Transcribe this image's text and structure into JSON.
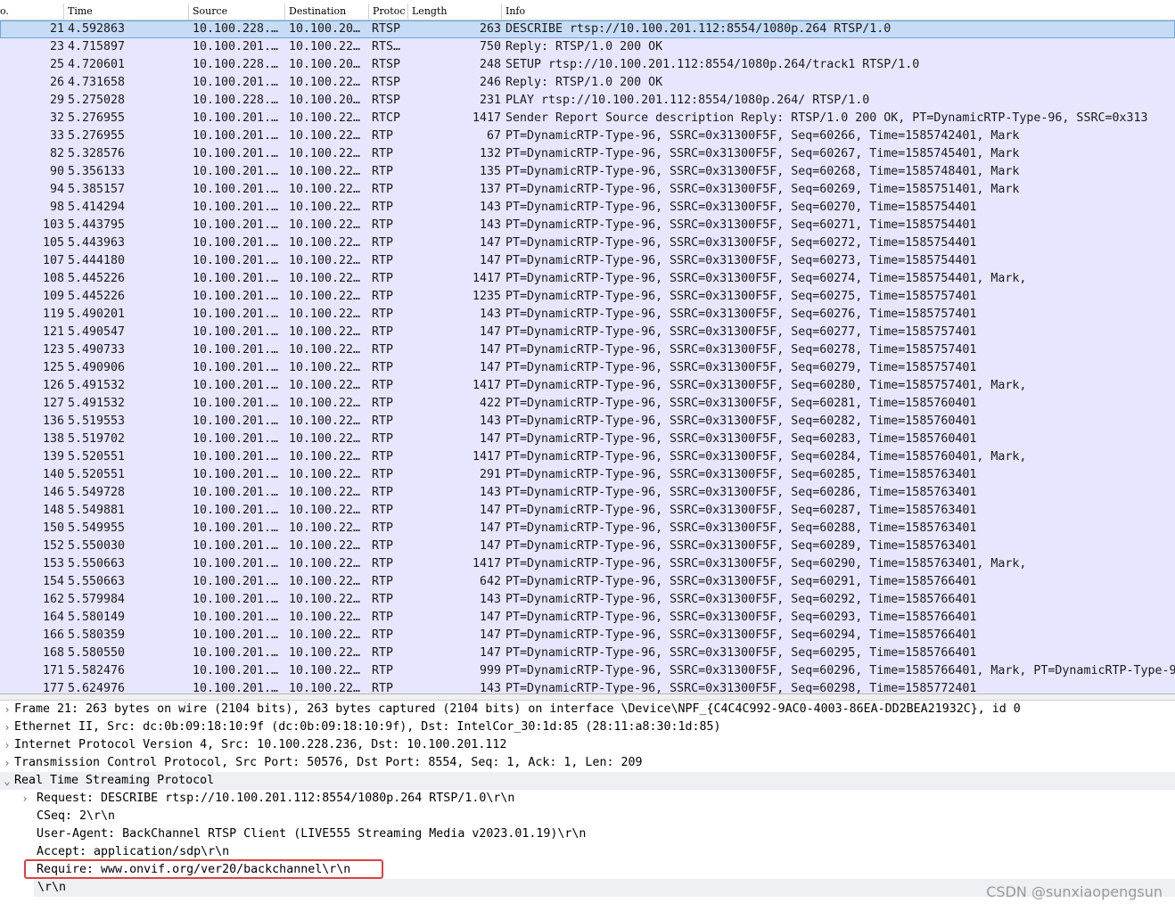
{
  "packet_list": {
    "columns": [
      "o.",
      "Time",
      "Source",
      "Destination",
      "Protoc",
      "Length",
      "Info"
    ],
    "rows": [
      {
        "no": "21",
        "time": "4.592863",
        "src": "10.100.228.…",
        "dst": "10.100.20…",
        "proto": "RTSP",
        "len": "263",
        "info": "DESCRIBE rtsp://10.100.201.112:8554/1080p.264 RTSP/1.0",
        "selected": true
      },
      {
        "no": "23",
        "time": "4.715897",
        "src": "10.100.201.…",
        "dst": "10.100.22…",
        "proto": "RTS…",
        "len": "750",
        "info": "Reply: RTSP/1.0 200 OK"
      },
      {
        "no": "25",
        "time": "4.720601",
        "src": "10.100.228.…",
        "dst": "10.100.20…",
        "proto": "RTSP",
        "len": "248",
        "info": "SETUP rtsp://10.100.201.112:8554/1080p.264/track1 RTSP/1.0"
      },
      {
        "no": "26",
        "time": "4.731658",
        "src": "10.100.201.…",
        "dst": "10.100.22…",
        "proto": "RTSP",
        "len": "246",
        "info": "Reply: RTSP/1.0 200 OK"
      },
      {
        "no": "29",
        "time": "5.275028",
        "src": "10.100.228.…",
        "dst": "10.100.20…",
        "proto": "RTSP",
        "len": "231",
        "info": "PLAY rtsp://10.100.201.112:8554/1080p.264/ RTSP/1.0"
      },
      {
        "no": "32",
        "time": "5.276955",
        "src": "10.100.201.…",
        "dst": "10.100.22…",
        "proto": "RTCP",
        "len": "1417",
        "info": "Sender Report   Source description   Reply: RTSP/1.0 200 OK, PT=DynamicRTP-Type-96, SSRC=0x313"
      },
      {
        "no": "33",
        "time": "5.276955",
        "src": "10.100.201.…",
        "dst": "10.100.22…",
        "proto": "RTP",
        "len": "67",
        "info": "PT=DynamicRTP-Type-96, SSRC=0x31300F5F, Seq=60266, Time=1585742401, Mark"
      },
      {
        "no": "82",
        "time": "5.328576",
        "src": "10.100.201.…",
        "dst": "10.100.22…",
        "proto": "RTP",
        "len": "132",
        "info": "PT=DynamicRTP-Type-96, SSRC=0x31300F5F, Seq=60267, Time=1585745401, Mark"
      },
      {
        "no": "90",
        "time": "5.356133",
        "src": "10.100.201.…",
        "dst": "10.100.22…",
        "proto": "RTP",
        "len": "135",
        "info": "PT=DynamicRTP-Type-96, SSRC=0x31300F5F, Seq=60268, Time=1585748401, Mark"
      },
      {
        "no": "94",
        "time": "5.385157",
        "src": "10.100.201.…",
        "dst": "10.100.22…",
        "proto": "RTP",
        "len": "137",
        "info": "PT=DynamicRTP-Type-96, SSRC=0x31300F5F, Seq=60269, Time=1585751401, Mark"
      },
      {
        "no": "98",
        "time": "5.414294",
        "src": "10.100.201.…",
        "dst": "10.100.22…",
        "proto": "RTP",
        "len": "143",
        "info": "PT=DynamicRTP-Type-96, SSRC=0x31300F5F, Seq=60270, Time=1585754401"
      },
      {
        "no": "103",
        "time": "5.443795",
        "src": "10.100.201.…",
        "dst": "10.100.22…",
        "proto": "RTP",
        "len": "143",
        "info": "PT=DynamicRTP-Type-96, SSRC=0x31300F5F, Seq=60271, Time=1585754401"
      },
      {
        "no": "105",
        "time": "5.443963",
        "src": "10.100.201.…",
        "dst": "10.100.22…",
        "proto": "RTP",
        "len": "147",
        "info": "PT=DynamicRTP-Type-96, SSRC=0x31300F5F, Seq=60272, Time=1585754401"
      },
      {
        "no": "107",
        "time": "5.444180",
        "src": "10.100.201.…",
        "dst": "10.100.22…",
        "proto": "RTP",
        "len": "147",
        "info": "PT=DynamicRTP-Type-96, SSRC=0x31300F5F, Seq=60273, Time=1585754401"
      },
      {
        "no": "108",
        "time": "5.445226",
        "src": "10.100.201.…",
        "dst": "10.100.22…",
        "proto": "RTP",
        "len": "1417",
        "info": "PT=DynamicRTP-Type-96, SSRC=0x31300F5F, Seq=60274, Time=1585754401, Mark,"
      },
      {
        "no": "109",
        "time": "5.445226",
        "src": "10.100.201.…",
        "dst": "10.100.22…",
        "proto": "RTP",
        "len": "1235",
        "info": "PT=DynamicRTP-Type-96, SSRC=0x31300F5F, Seq=60275, Time=1585757401"
      },
      {
        "no": "119",
        "time": "5.490201",
        "src": "10.100.201.…",
        "dst": "10.100.22…",
        "proto": "RTP",
        "len": "143",
        "info": "PT=DynamicRTP-Type-96, SSRC=0x31300F5F, Seq=60276, Time=1585757401"
      },
      {
        "no": "121",
        "time": "5.490547",
        "src": "10.100.201.…",
        "dst": "10.100.22…",
        "proto": "RTP",
        "len": "147",
        "info": "PT=DynamicRTP-Type-96, SSRC=0x31300F5F, Seq=60277, Time=1585757401"
      },
      {
        "no": "123",
        "time": "5.490733",
        "src": "10.100.201.…",
        "dst": "10.100.22…",
        "proto": "RTP",
        "len": "147",
        "info": "PT=DynamicRTP-Type-96, SSRC=0x31300F5F, Seq=60278, Time=1585757401"
      },
      {
        "no": "125",
        "time": "5.490906",
        "src": "10.100.201.…",
        "dst": "10.100.22…",
        "proto": "RTP",
        "len": "147",
        "info": "PT=DynamicRTP-Type-96, SSRC=0x31300F5F, Seq=60279, Time=1585757401"
      },
      {
        "no": "126",
        "time": "5.491532",
        "src": "10.100.201.…",
        "dst": "10.100.22…",
        "proto": "RTP",
        "len": "1417",
        "info": "PT=DynamicRTP-Type-96, SSRC=0x31300F5F, Seq=60280, Time=1585757401, Mark,"
      },
      {
        "no": "127",
        "time": "5.491532",
        "src": "10.100.201.…",
        "dst": "10.100.22…",
        "proto": "RTP",
        "len": "422",
        "info": "PT=DynamicRTP-Type-96, SSRC=0x31300F5F, Seq=60281, Time=1585760401"
      },
      {
        "no": "136",
        "time": "5.519553",
        "src": "10.100.201.…",
        "dst": "10.100.22…",
        "proto": "RTP",
        "len": "143",
        "info": "PT=DynamicRTP-Type-96, SSRC=0x31300F5F, Seq=60282, Time=1585760401"
      },
      {
        "no": "138",
        "time": "5.519702",
        "src": "10.100.201.…",
        "dst": "10.100.22…",
        "proto": "RTP",
        "len": "147",
        "info": "PT=DynamicRTP-Type-96, SSRC=0x31300F5F, Seq=60283, Time=1585760401"
      },
      {
        "no": "139",
        "time": "5.520551",
        "src": "10.100.201.…",
        "dst": "10.100.22…",
        "proto": "RTP",
        "len": "1417",
        "info": "PT=DynamicRTP-Type-96, SSRC=0x31300F5F, Seq=60284, Time=1585760401, Mark,"
      },
      {
        "no": "140",
        "time": "5.520551",
        "src": "10.100.201.…",
        "dst": "10.100.22…",
        "proto": "RTP",
        "len": "291",
        "info": "PT=DynamicRTP-Type-96, SSRC=0x31300F5F, Seq=60285, Time=1585763401"
      },
      {
        "no": "146",
        "time": "5.549728",
        "src": "10.100.201.…",
        "dst": "10.100.22…",
        "proto": "RTP",
        "len": "143",
        "info": "PT=DynamicRTP-Type-96, SSRC=0x31300F5F, Seq=60286, Time=1585763401"
      },
      {
        "no": "148",
        "time": "5.549881",
        "src": "10.100.201.…",
        "dst": "10.100.22…",
        "proto": "RTP",
        "len": "147",
        "info": "PT=DynamicRTP-Type-96, SSRC=0x31300F5F, Seq=60287, Time=1585763401"
      },
      {
        "no": "150",
        "time": "5.549955",
        "src": "10.100.201.…",
        "dst": "10.100.22…",
        "proto": "RTP",
        "len": "147",
        "info": "PT=DynamicRTP-Type-96, SSRC=0x31300F5F, Seq=60288, Time=1585763401"
      },
      {
        "no": "152",
        "time": "5.550030",
        "src": "10.100.201.…",
        "dst": "10.100.22…",
        "proto": "RTP",
        "len": "147",
        "info": "PT=DynamicRTP-Type-96, SSRC=0x31300F5F, Seq=60289, Time=1585763401"
      },
      {
        "no": "153",
        "time": "5.550663",
        "src": "10.100.201.…",
        "dst": "10.100.22…",
        "proto": "RTP",
        "len": "1417",
        "info": "PT=DynamicRTP-Type-96, SSRC=0x31300F5F, Seq=60290, Time=1585763401, Mark,"
      },
      {
        "no": "154",
        "time": "5.550663",
        "src": "10.100.201.…",
        "dst": "10.100.22…",
        "proto": "RTP",
        "len": "642",
        "info": "PT=DynamicRTP-Type-96, SSRC=0x31300F5F, Seq=60291, Time=1585766401"
      },
      {
        "no": "162",
        "time": "5.579984",
        "src": "10.100.201.…",
        "dst": "10.100.22…",
        "proto": "RTP",
        "len": "143",
        "info": "PT=DynamicRTP-Type-96, SSRC=0x31300F5F, Seq=60292, Time=1585766401"
      },
      {
        "no": "164",
        "time": "5.580149",
        "src": "10.100.201.…",
        "dst": "10.100.22…",
        "proto": "RTP",
        "len": "147",
        "info": "PT=DynamicRTP-Type-96, SSRC=0x31300F5F, Seq=60293, Time=1585766401"
      },
      {
        "no": "166",
        "time": "5.580359",
        "src": "10.100.201.…",
        "dst": "10.100.22…",
        "proto": "RTP",
        "len": "147",
        "info": "PT=DynamicRTP-Type-96, SSRC=0x31300F5F, Seq=60294, Time=1585766401"
      },
      {
        "no": "168",
        "time": "5.580550",
        "src": "10.100.201.…",
        "dst": "10.100.22…",
        "proto": "RTP",
        "len": "147",
        "info": "PT=DynamicRTP-Type-96, SSRC=0x31300F5F, Seq=60295, Time=1585766401"
      },
      {
        "no": "171",
        "time": "5.582476",
        "src": "10.100.201.…",
        "dst": "10.100.22…",
        "proto": "RTP",
        "len": "999",
        "info": "PT=DynamicRTP-Type-96, SSRC=0x31300F5F, Seq=60296, Time=1585766401, Mark, PT=DynamicRTP-Type-9"
      },
      {
        "no": "177",
        "time": "5.624976",
        "src": "10.100.201.…",
        "dst": "10.100.22…",
        "proto": "RTP",
        "len": "143",
        "info": "PT=DynamicRTP-Type-96, SSRC=0x31300F5F, Seq=60298, Time=1585772401"
      }
    ]
  },
  "details": {
    "rows": [
      {
        "text": "Frame 21: 263 bytes on wire (2104 bits), 263 bytes captured (2104 bits) on interface \\Device\\NPF_{C4C4C992-9AC0-4003-86EA-DD2BEA21932C}, id 0",
        "arrow": "›"
      },
      {
        "text": "Ethernet II, Src: dc:0b:09:18:10:9f (dc:0b:09:18:10:9f), Dst: IntelCor_30:1d:85 (28:11:a8:30:1d:85)",
        "arrow": "›"
      },
      {
        "text": "Internet Protocol Version 4, Src: 10.100.228.236, Dst: 10.100.201.112",
        "arrow": "›"
      },
      {
        "text": "Transmission Control Protocol, Src Port: 50576, Dst Port: 8554, Seq: 1, Ack: 1, Len: 209",
        "arrow": "›"
      },
      {
        "text": "Real Time Streaming Protocol",
        "arrow": "⌄",
        "tint": true
      },
      {
        "text": "Request: DESCRIBE rtsp://10.100.201.112:8554/1080p.264 RTSP/1.0\\r\\n",
        "arrow": "›"
      },
      {
        "text": "CSeq: 2\\r\\n",
        "arrow": ""
      },
      {
        "text": "User-Agent: BackChannel RTSP Client (LIVE555 Streaming Media v2023.01.19)\\r\\n",
        "arrow": ""
      },
      {
        "text": "Accept: application/sdp\\r\\n",
        "arrow": ""
      },
      {
        "text": "Require: www.onvif.org/ver20/backchannel\\r\\n",
        "arrow": ""
      },
      {
        "text": "\\r\\n",
        "arrow": "",
        "tint": true
      }
    ]
  },
  "watermark": "CSDN @sunxiaopengsun",
  "colors": {
    "row_bg": "#e7e6ff",
    "selected_bg": "#c6dbf6",
    "highlight_box": "#e04040"
  }
}
